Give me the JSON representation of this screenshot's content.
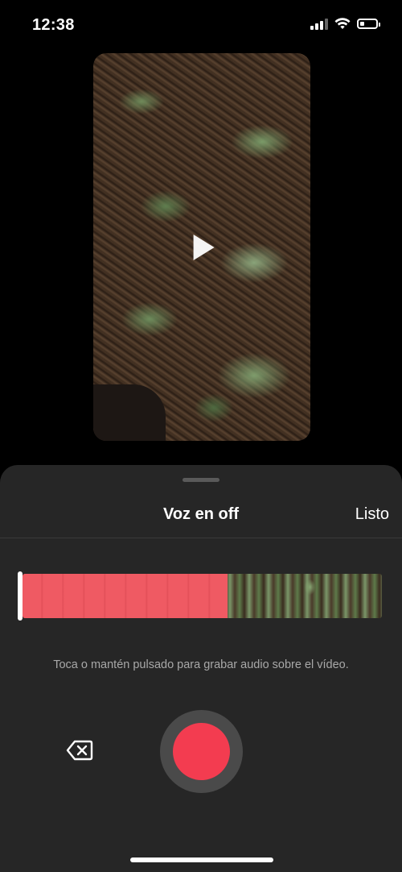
{
  "status_bar": {
    "time": "12:38",
    "icons": [
      "cellular-signal-icon",
      "wifi-icon",
      "battery-icon"
    ],
    "signal_bars_active": 3,
    "signal_bars_total": 4,
    "battery_level": 0.3
  },
  "video": {
    "play_icon": "play-icon"
  },
  "sheet": {
    "title": "Voz en off",
    "done_label": "Listo",
    "timeline": {
      "recorded_fraction": 0.57,
      "recorded_color": "#ef5a63"
    },
    "hint": "Toca o mantén pulsado para grabar audio sobre el vídeo.",
    "delete_icon": "backspace-icon",
    "record_icon": "record-button",
    "record_color": "#f33c50"
  }
}
